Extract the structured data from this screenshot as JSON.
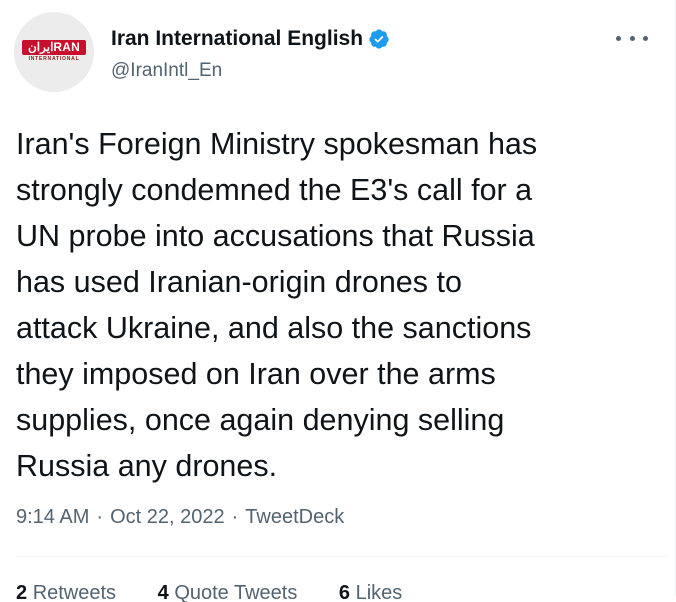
{
  "author": {
    "display_name": "Iran International English",
    "handle": "@IranIntl_En",
    "avatar_logo_text": "ايرانRAN",
    "avatar_logo_subtext": "INTERNATIONAL",
    "verified": true
  },
  "tweet": {
    "text": "Iran's Foreign Ministry spokesman has\nstrongly condemned the E3's call for a\nUN probe into accusations that Russia\nhas used Iranian-origin drones to\nattack Ukraine, and also the sanctions\nthey imposed on Iran over the arms\nsupplies, once again denying selling\nRussia any drones.",
    "time": "9:14 AM",
    "separator": "·",
    "date": "Oct 22, 2022",
    "source": "TweetDeck"
  },
  "stats": {
    "retweets_count": "2",
    "retweets_label": "Retweets",
    "quotes_count": "4",
    "quotes_label": "Quote Tweets",
    "likes_count": "6",
    "likes_label": "Likes"
  },
  "colors": {
    "text_primary": "#0f1419",
    "text_secondary": "#536471",
    "verified_blue": "#1d9bf0",
    "brand_red": "#c8102e"
  }
}
